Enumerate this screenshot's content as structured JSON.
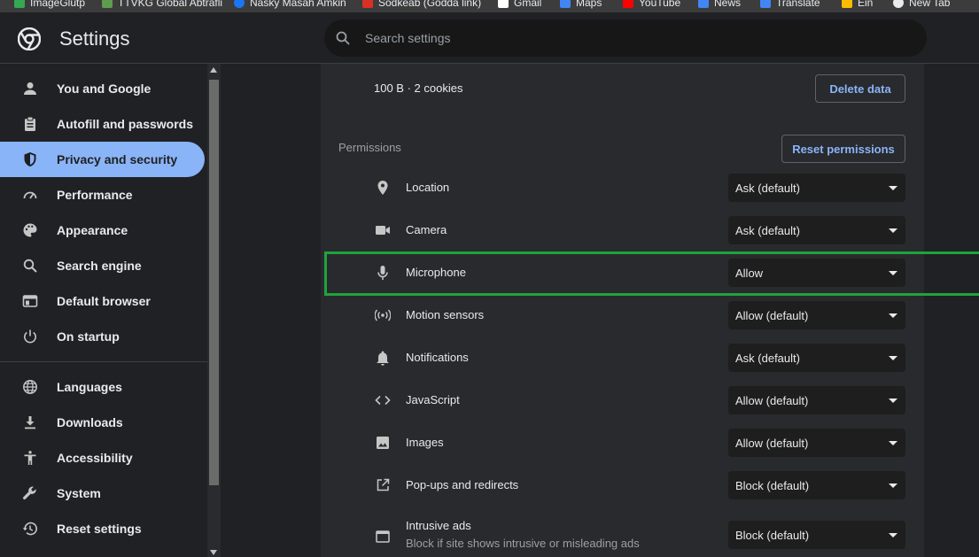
{
  "bookmarks": [
    {
      "label": "ImageGlutp",
      "color": "#34a853"
    },
    {
      "label": "TTVKG Global Abtrafli",
      "color": "#5f9c4f"
    },
    {
      "label": "Nasky Masah Amkin",
      "color": "#1877f2"
    },
    {
      "label": "Sodkeab (Godda link)",
      "color": "#d93025"
    },
    {
      "label": "Gmail",
      "color": "#ffffff"
    },
    {
      "label": "Maps",
      "color": "#4285f4"
    },
    {
      "label": "YouTube",
      "color": "#ff0000"
    },
    {
      "label": "News",
      "color": "#4285f4"
    },
    {
      "label": "Translate",
      "color": "#4285f4"
    },
    {
      "label": "Ein",
      "color": "#fbbc04"
    },
    {
      "label": "New Tab",
      "color": "#e8eaed"
    }
  ],
  "header": {
    "title": "Settings",
    "search_placeholder": "Search settings"
  },
  "sidebar": {
    "items": [
      {
        "label": "You and Google",
        "icon": "person-icon",
        "active": false
      },
      {
        "label": "Autofill and passwords",
        "icon": "clipboard-icon",
        "active": false
      },
      {
        "label": "Privacy and security",
        "icon": "shield-icon",
        "active": true
      },
      {
        "label": "Performance",
        "icon": "speedometer-icon",
        "active": false
      },
      {
        "label": "Appearance",
        "icon": "palette-icon",
        "active": false
      },
      {
        "label": "Search engine",
        "icon": "search-icon",
        "active": false
      },
      {
        "label": "Default browser",
        "icon": "browser-icon",
        "active": false
      },
      {
        "label": "On startup",
        "icon": "power-icon",
        "active": false
      },
      {
        "label": "Languages",
        "icon": "globe-icon",
        "active": false
      },
      {
        "label": "Downloads",
        "icon": "download-icon",
        "active": false
      },
      {
        "label": "Accessibility",
        "icon": "accessibility-icon",
        "active": false
      },
      {
        "label": "System",
        "icon": "wrench-icon",
        "active": false
      },
      {
        "label": "Reset settings",
        "icon": "history-icon",
        "active": false
      }
    ]
  },
  "site": {
    "usage": "100 B · 2 cookies",
    "delete_label": "Delete data"
  },
  "permissions": {
    "title": "Permissions",
    "reset_label": "Reset permissions",
    "rows": [
      {
        "label": "Location",
        "icon": "location-pin-icon",
        "value": "Ask (default)"
      },
      {
        "label": "Camera",
        "icon": "camera-icon",
        "value": "Ask (default)"
      },
      {
        "label": "Microphone",
        "icon": "microphone-icon",
        "value": "Allow",
        "highlighted": true
      },
      {
        "label": "Motion sensors",
        "icon": "motion-sensors-icon",
        "value": "Allow (default)"
      },
      {
        "label": "Notifications",
        "icon": "bell-icon",
        "value": "Ask (default)"
      },
      {
        "label": "JavaScript",
        "icon": "code-icon",
        "value": "Allow (default)"
      },
      {
        "label": "Images",
        "icon": "image-icon",
        "value": "Allow (default)"
      },
      {
        "label": "Pop-ups and redirects",
        "icon": "open-in-new-icon",
        "value": "Block (default)"
      },
      {
        "label": "Intrusive ads",
        "sublabel": "Block if site shows intrusive or misleading ads",
        "icon": "ads-window-icon",
        "value": "Block (default)"
      }
    ]
  },
  "colors": {
    "accent": "#8ab4f8",
    "highlight": "#1fa33d",
    "background": "#202124",
    "card": "#292a2d"
  }
}
